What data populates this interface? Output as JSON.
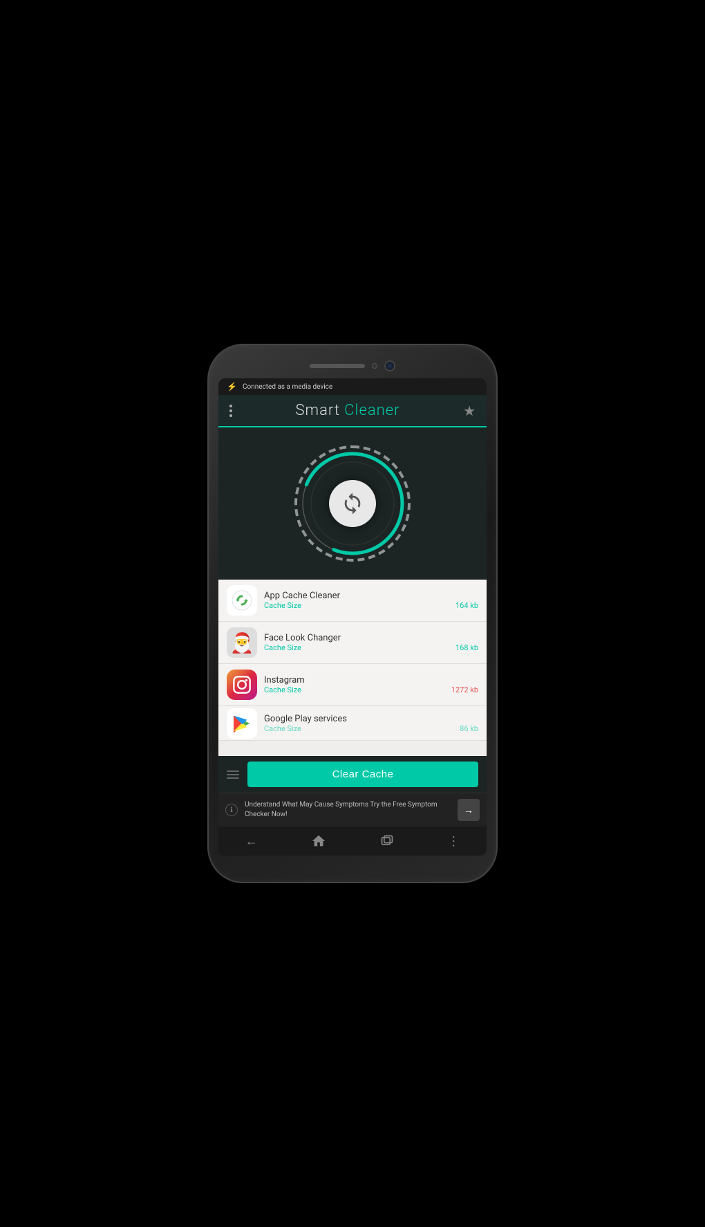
{
  "phone": {
    "status_bar": {
      "usb_icon": "⚡",
      "status_text": "Connected as a media device"
    },
    "header": {
      "menu_label": "⋮",
      "title_part1": "Smart ",
      "title_part2": "Cleaner",
      "star_icon": "★"
    },
    "apps": [
      {
        "name": "App Cache Cleaner",
        "cache_label": "Cache Size",
        "cache_size": "164 kb",
        "icon_type": "cleaner"
      },
      {
        "name": "Face Look Changer",
        "cache_label": "Cache Size",
        "cache_size": "168 kb",
        "icon_type": "face"
      },
      {
        "name": "Instagram",
        "cache_label": "Cache Size",
        "cache_size": "1272 kb",
        "icon_type": "instagram"
      },
      {
        "name": "Google Play services",
        "cache_label": "Cache Size",
        "cache_size": "86 kb",
        "icon_type": "google-play"
      }
    ],
    "clear_cache_button": "Clear Cache",
    "ad": {
      "text": "Understand What May Cause Symptoms Try the Free Symptom Checker Now!",
      "arrow": "→"
    },
    "nav": {
      "back": "←",
      "home": "⌂",
      "recents": "▭",
      "menu": "⋮"
    }
  }
}
